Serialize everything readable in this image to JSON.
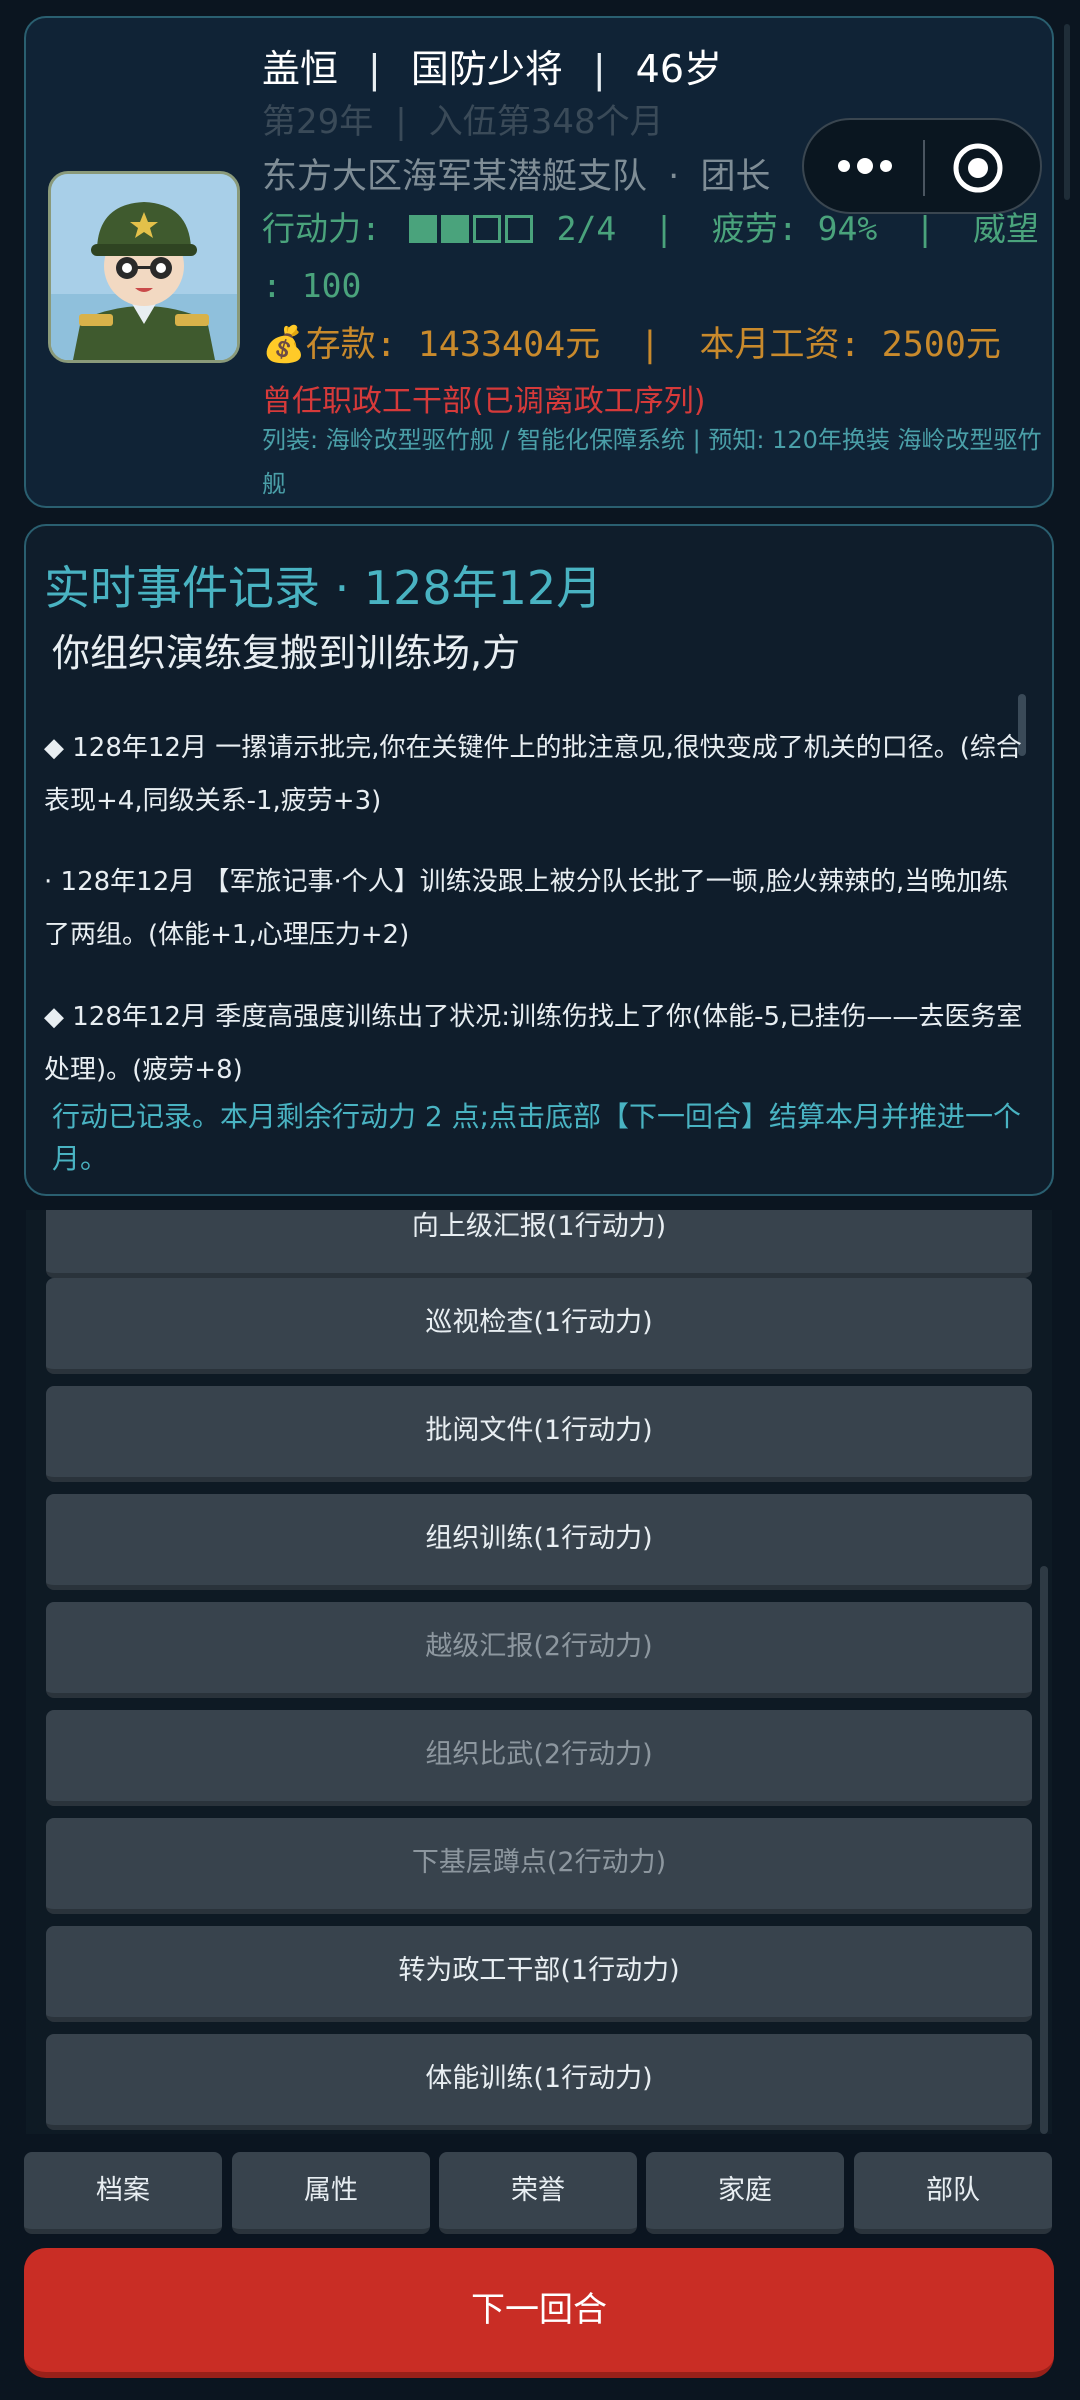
{
  "profile": {
    "name": "盖恒",
    "rank": "国防少将",
    "age": "46岁",
    "service_year": "第29年",
    "service_months": "入伍第348个月",
    "unit": "东方大区海军某潜艇支队",
    "unit_sep": "·",
    "position": "团长",
    "action_label": "行动力:",
    "action_points": {
      "current": 2,
      "max": 4
    },
    "action_text": "2/4",
    "fatigue": "疲劳: 94%",
    "prestige_label": "威望",
    "prestige_value": ": 100",
    "money_icon": "moneybag-icon",
    "savings": "存款: 1433404元",
    "salary": "本月工资: 2500元",
    "former_post": "曾任职政工干部(已调离政工序列)",
    "equipment": "列装: 海岭改型驱竹舰 / 智能化保障系统 | 预知: 120年换装 海岭改型驱竹舰"
  },
  "events": {
    "title": "实时事件记录 · 128年12月",
    "subtitle": "你组织演练复搬到训练场,方",
    "items": [
      {
        "text": "◆ 128年12月 一摞请示批完,你在关键件上的批注意见,很快变成了机关的口径。(综合表现+4,同级关系-1,疲劳+3)"
      },
      {
        "text": "· 128年12月 【军旅记事·个人】训练没跟上被分队长批了一顿,脸火辣辣的,当晚加练了两组。(体能+1,心理压力+2)"
      },
      {
        "text": "◆ 128年12月 季度高强度训练出了状况:训练伤找上了你(体能-5,已挂伤——去医务室处理)。(疲劳+8)"
      }
    ],
    "footer": "行动已记录。本月剩余行动力 2 点;点击底部【下一回合】结算本月并推进一个月。"
  },
  "actions": [
    {
      "label": "向上级汇报(1行动力)",
      "enabled": true
    },
    {
      "label": "巡视检查(1行动力)",
      "enabled": true
    },
    {
      "label": "批阅文件(1行动力)",
      "enabled": true
    },
    {
      "label": "组织训练(1行动力)",
      "enabled": true
    },
    {
      "label": "越级汇报(2行动力)",
      "enabled": false
    },
    {
      "label": "组织比武(2行动力)",
      "enabled": false
    },
    {
      "label": "下基层蹲点(2行动力)",
      "enabled": false
    },
    {
      "label": "转为政工干部(1行动力)",
      "enabled": true
    },
    {
      "label": "体能训练(1行动力)",
      "enabled": true
    }
  ],
  "tabs": [
    "档案",
    "属性",
    "荣誉",
    "家庭",
    "部队"
  ],
  "next_turn": "下一回合",
  "capsule": {
    "more_icon": "more-dots-icon",
    "close_icon": "target-close-icon"
  }
}
